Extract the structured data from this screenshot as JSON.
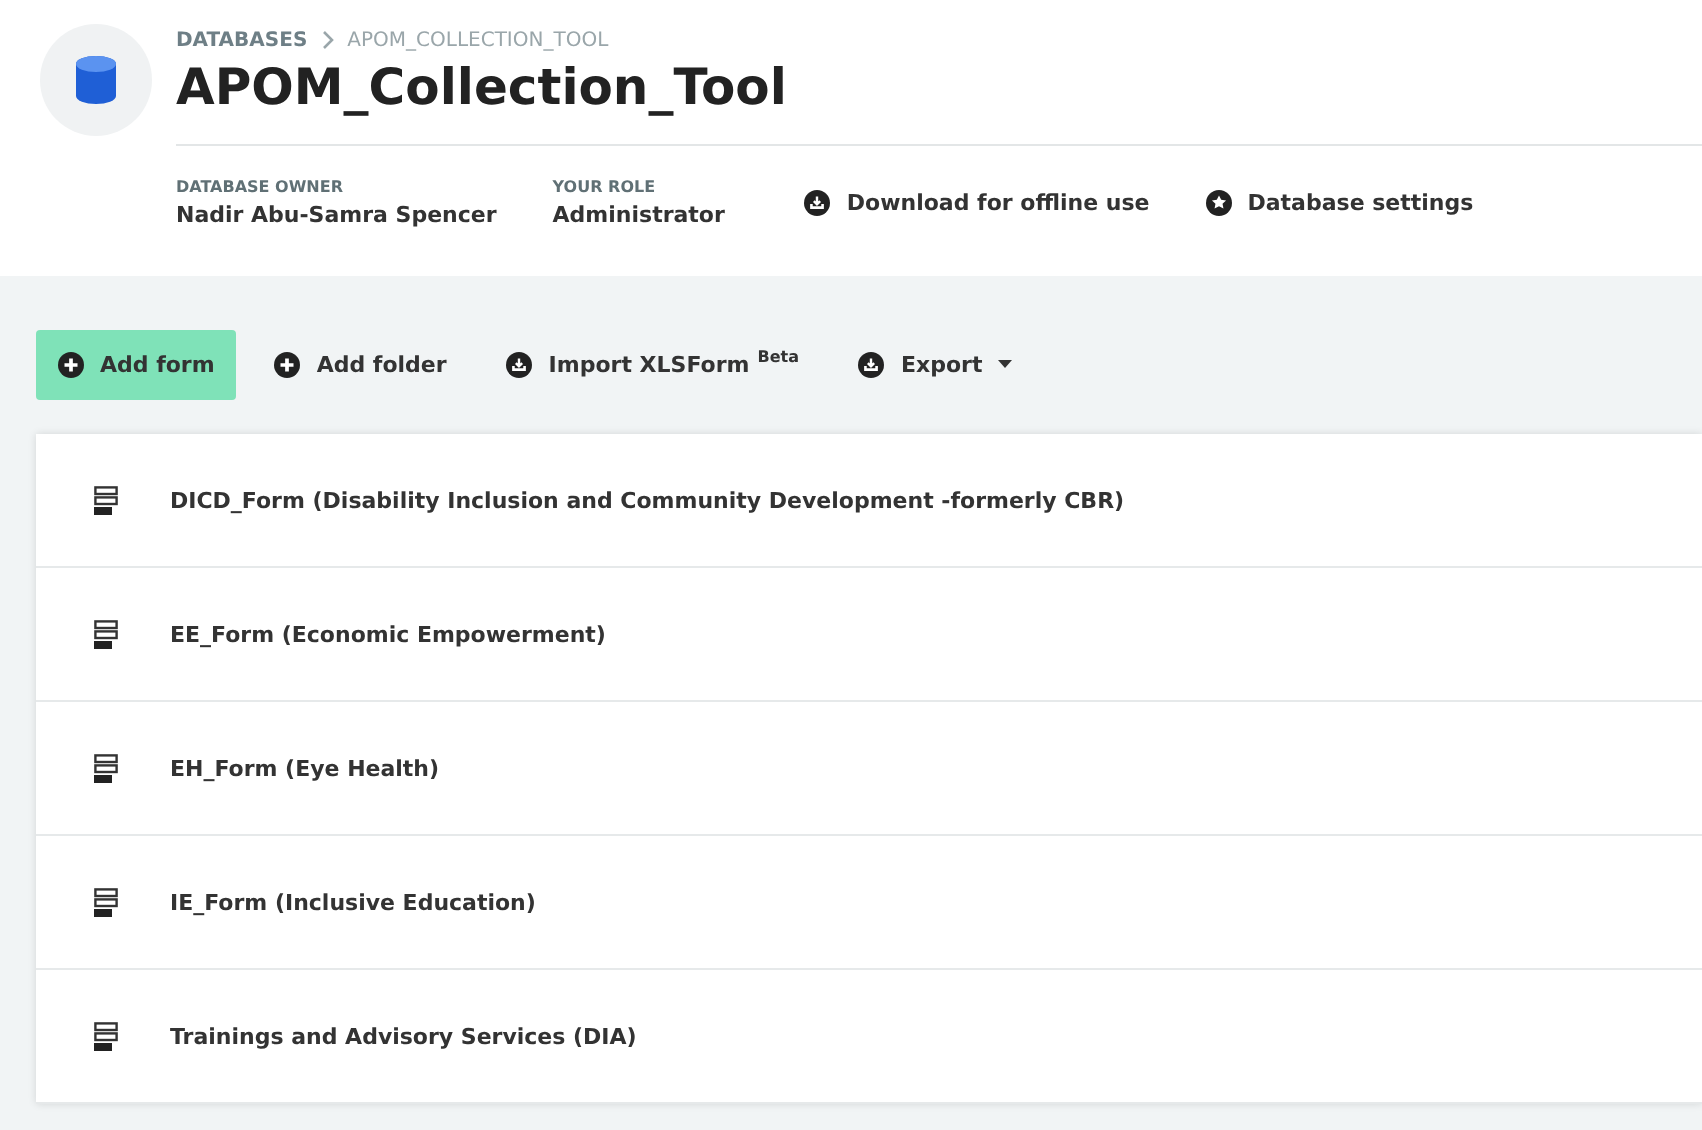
{
  "breadcrumb": [
    {
      "label": "DATABASES"
    },
    {
      "label": "APOM_COLLECTION_TOOL"
    }
  ],
  "title": "APOM_Collection_Tool",
  "meta": [
    {
      "label": "DATABASE OWNER",
      "value": "Nadir Abu-Samra Spencer"
    },
    {
      "label": "YOUR ROLE",
      "value": "Administrator"
    }
  ],
  "header_actions": [
    {
      "label": "Download for offline use",
      "kind": "download"
    },
    {
      "label": "Database settings",
      "kind": "settings"
    }
  ],
  "toolbar": [
    {
      "label": "Add form",
      "kind": "add",
      "primary": true
    },
    {
      "label": "Add folder",
      "kind": "add",
      "primary": false
    },
    {
      "label": "Import XLSForm",
      "badge": "Beta",
      "kind": "download",
      "primary": false
    },
    {
      "label": "Export",
      "kind": "download",
      "primary": false,
      "dropdown": true
    }
  ],
  "forms": [
    {
      "name": "DICD_Form (Disability Inclusion and Community Development -formerly CBR)"
    },
    {
      "name": "EE_Form (Economic Empowerment)"
    },
    {
      "name": "EH_Form (Eye Health)"
    },
    {
      "name": "IE_Form (Inclusive Education)"
    },
    {
      "name": "Trainings and Advisory Services (DIA)"
    }
  ]
}
